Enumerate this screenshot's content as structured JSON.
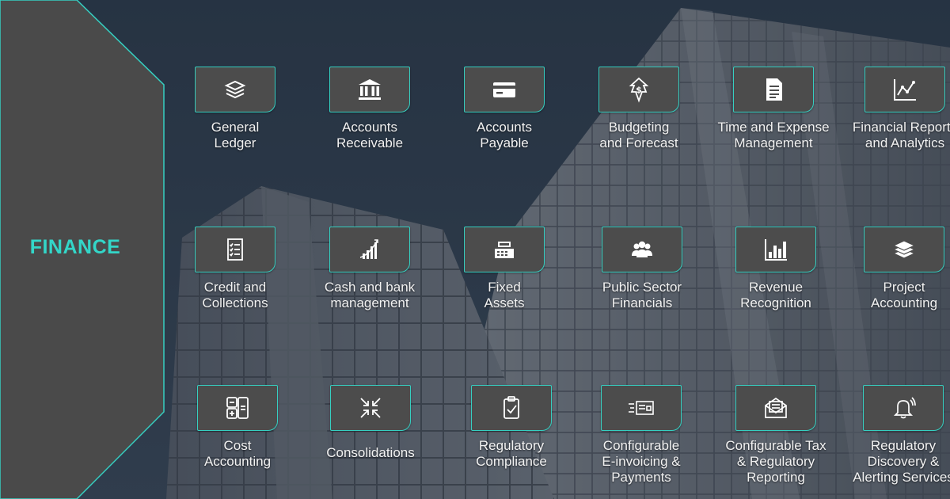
{
  "section": {
    "title": "FINANCE"
  },
  "colors": {
    "accent": "#36cfc1",
    "panel": "#4a4a4a",
    "tile": "#4c4c4c",
    "sky": "#2f3f52"
  },
  "tiles": [
    {
      "label": "General\nLedger",
      "icon": "stack-icon"
    },
    {
      "label": "Accounts\nReceivable",
      "icon": "bank-icon"
    },
    {
      "label": "Accounts\nPayable",
      "icon": "credit-card-icon"
    },
    {
      "label": "Budgeting\nand Forecast",
      "icon": "dollar-bolt-icon"
    },
    {
      "label": "Time and Expense\nManagement",
      "icon": "document-icon"
    },
    {
      "label": "Financial Reports\nand Analytics",
      "icon": "line-chart-icon"
    },
    {
      "label": "Credit and\nCollections",
      "icon": "checklist-icon"
    },
    {
      "label": "Cash and bank\nmanagement",
      "icon": "growth-bars-icon"
    },
    {
      "label": "Fixed\nAssets",
      "icon": "cash-register-icon"
    },
    {
      "label": "Public Sector\nFinancials",
      "icon": "people-group-icon"
    },
    {
      "label": "Revenue\nRecognition",
      "icon": "bar-chart-icon"
    },
    {
      "label": "Project\nAccounting",
      "icon": "layers-icon"
    },
    {
      "label": "Cost\nAccounting",
      "icon": "calculator-icon"
    },
    {
      "label": "Consolidations",
      "icon": "compress-arrows-icon"
    },
    {
      "label": "Regulatory\nCompliance",
      "icon": "clipboard-check-icon"
    },
    {
      "label": "Configurable\nE-invoicing &\nPayments",
      "icon": "invoice-icon"
    },
    {
      "label": "Configurable Tax\n& Regulatory\nReporting",
      "icon": "tax-report-icon"
    },
    {
      "label": "Regulatory\nDiscovery &\nAlerting Services",
      "icon": "bell-alert-icon"
    }
  ]
}
